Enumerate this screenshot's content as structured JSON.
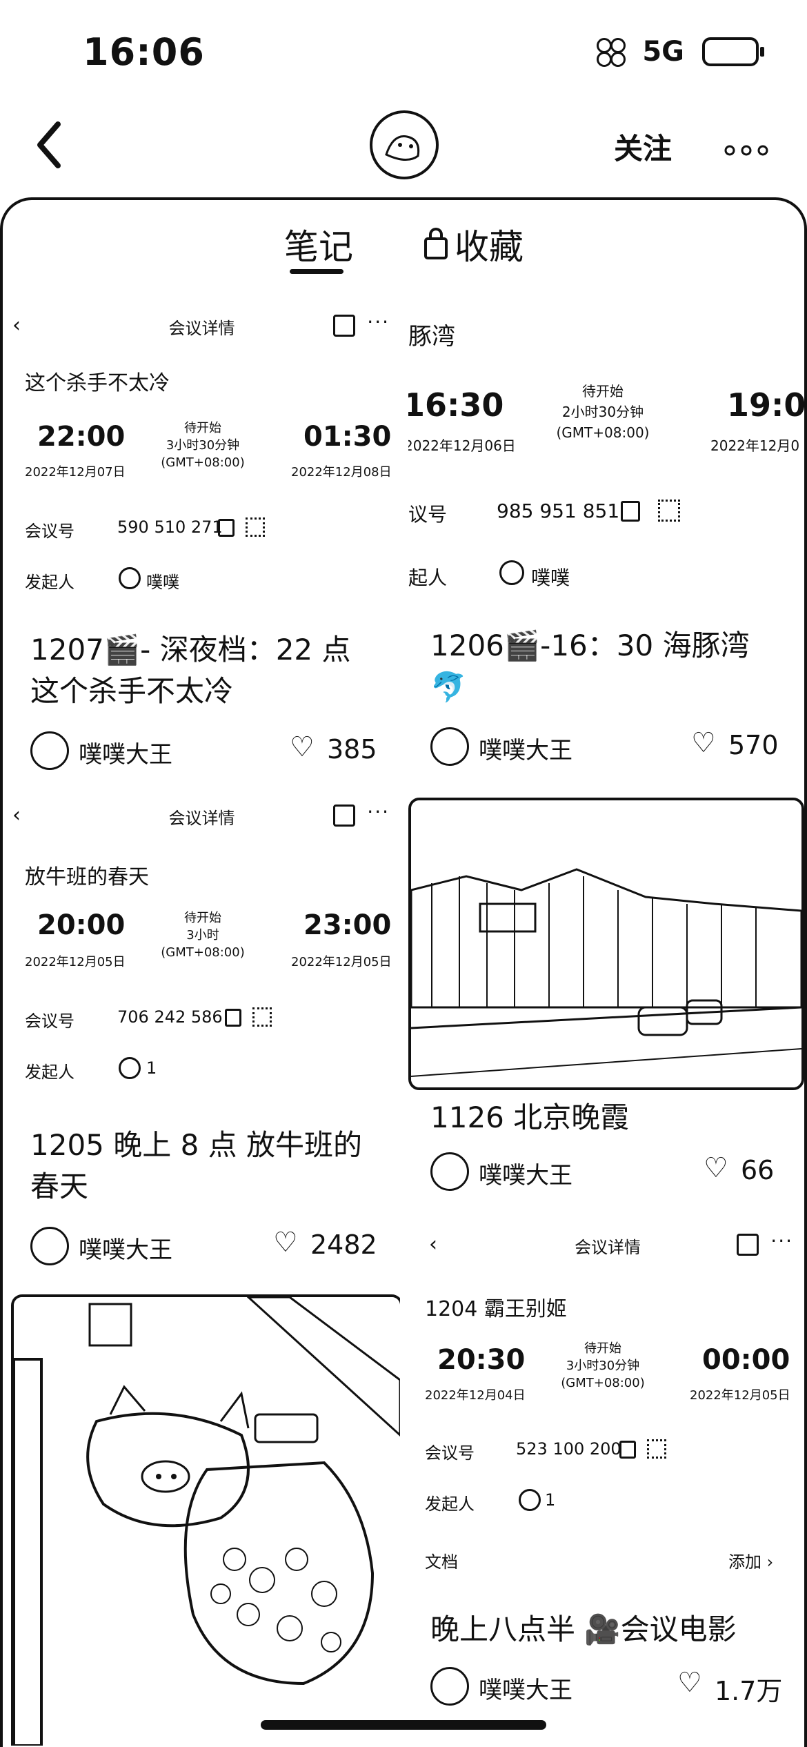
{
  "status_bar": {
    "time": "16:06",
    "network": "5G"
  },
  "header": {
    "follow_label": "关注",
    "more_label": "⋯"
  },
  "tabs": {
    "notes": "笔记",
    "favorites": "收藏"
  },
  "notes": [
    {
      "meeting": {
        "header_title": "会议详情",
        "name": "这个杀手不太冷",
        "start": "22:00",
        "start_date": "2022年12月07日",
        "status": "待开始",
        "duration": "3小时30分钟",
        "tz": "(GMT+08:00)",
        "end": "01:30",
        "end_date": "2022年12月08日",
        "id_label": "会议号",
        "id": "590 510 271",
        "host_label": "发起人",
        "host": "噗噗"
      },
      "title": "1207🎬- 深夜档：22 点 这个杀手不太冷",
      "author": "噗噗大王",
      "likes": "385"
    },
    {
      "meeting": {
        "name": "豚湾",
        "start": "16:30",
        "start_date": "2022年12月06日",
        "status": "待开始",
        "duration": "2小时30分钟",
        "tz": "(GMT+08:00)",
        "end": "19:0",
        "end_date": "2022年12月0",
        "id_label": "议号",
        "id": "985 951 851",
        "host_label": "起人",
        "host": "噗噗"
      },
      "title": "1206🎬-16：30 海豚湾 🐬",
      "author": "噗噗大王",
      "likes": "570"
    },
    {
      "meeting": {
        "header_title": "会议详情",
        "name": "放牛班的春天",
        "start": "20:00",
        "start_date": "2022年12月05日",
        "status": "待开始",
        "duration": "3小时",
        "tz": "(GMT+08:00)",
        "end": "23:00",
        "end_date": "2022年12月05日",
        "id_label": "会议号",
        "id": "706 242 586",
        "host_label": "发起人",
        "host": "1"
      },
      "title": "1205 晚上 8 点 放牛班的春天",
      "author": "噗噗大王",
      "likes": "2482"
    },
    {
      "title": "1126 北京晚霞",
      "author": "噗噗大王",
      "likes": "66"
    },
    {
      "meeting": {
        "header_title": "会议详情",
        "name": "1204 霸王别姬",
        "start": "20:30",
        "start_date": "2022年12月04日",
        "status": "待开始",
        "duration": "3小时30分钟",
        "tz": "(GMT+08:00)",
        "end": "00:00",
        "end_date": "2022年12月05日",
        "id_label": "会议号",
        "id": "523 100 200",
        "host_label": "发起人",
        "host": "1",
        "doc_label": "文档",
        "doc_action": "添加 ›"
      },
      "title": "晚上八点半 🎥会议电影",
      "author": "噗噗大王",
      "likes": "1.7万"
    }
  ]
}
